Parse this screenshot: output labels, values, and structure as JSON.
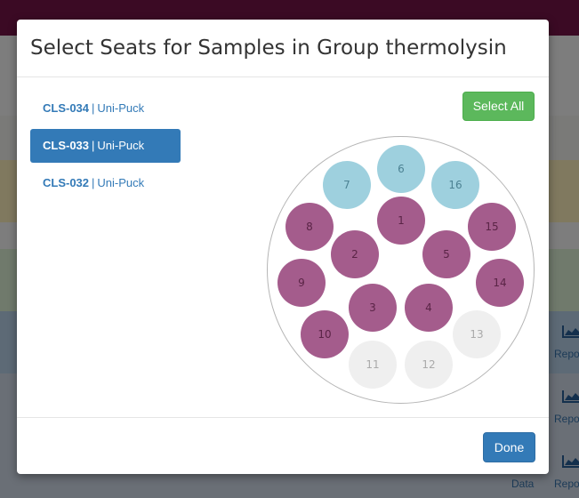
{
  "background": {
    "report_label": "Repo",
    "data_label": "Data"
  },
  "modal": {
    "title": "Select Seats for Samples in Group thermolysin",
    "select_all_label": "Select All",
    "done_label": "Done",
    "separator": "|",
    "containers": [
      {
        "name": "CLS-034",
        "type": "Uni-Puck",
        "active": false
      },
      {
        "name": "CLS-033",
        "type": "Uni-Puck",
        "active": true
      },
      {
        "name": "CLS-032",
        "type": "Uni-Puck",
        "active": false
      }
    ],
    "seats": [
      {
        "label": "1",
        "state": "selected"
      },
      {
        "label": "2",
        "state": "selected"
      },
      {
        "label": "3",
        "state": "selected"
      },
      {
        "label": "4",
        "state": "selected"
      },
      {
        "label": "5",
        "state": "selected"
      },
      {
        "label": "6",
        "state": "occupied"
      },
      {
        "label": "7",
        "state": "occupied"
      },
      {
        "label": "8",
        "state": "selected"
      },
      {
        "label": "9",
        "state": "selected"
      },
      {
        "label": "10",
        "state": "selected"
      },
      {
        "label": "11",
        "state": "empty"
      },
      {
        "label": "12",
        "state": "empty"
      },
      {
        "label": "13",
        "state": "empty"
      },
      {
        "label": "14",
        "state": "selected"
      },
      {
        "label": "15",
        "state": "selected"
      },
      {
        "label": "16",
        "state": "occupied"
      }
    ],
    "colors": {
      "selected": "#a45c8c",
      "occupied": "#9ed0de",
      "empty": "#efefef",
      "primary": "#337ab7",
      "success": "#5cb85c"
    }
  }
}
